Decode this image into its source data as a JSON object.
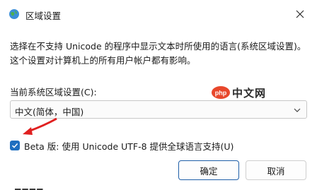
{
  "window": {
    "title": "区域设置",
    "icon": "globe-icon"
  },
  "description": "选择在不支持 Unicode 的程序中显示文本时所使用的语言(系统区域设置)。这个设置对计算机上的所有用户帐户都有影响。",
  "locale": {
    "label": "当前系统区域设置(C):",
    "selected": "中文(简体，中国)"
  },
  "watermark": {
    "logo_text": "php",
    "text": "中文网"
  },
  "beta_option": {
    "checked": true,
    "label": "Beta 版: 使用 Unicode UTF-8 提供全球语言支持(U)"
  },
  "buttons": {
    "ok": "确定",
    "cancel": "取消"
  },
  "partial_text": "▬▬▬▬",
  "colors": {
    "accent": "#1f6fc0",
    "arrow": "#e02020"
  }
}
